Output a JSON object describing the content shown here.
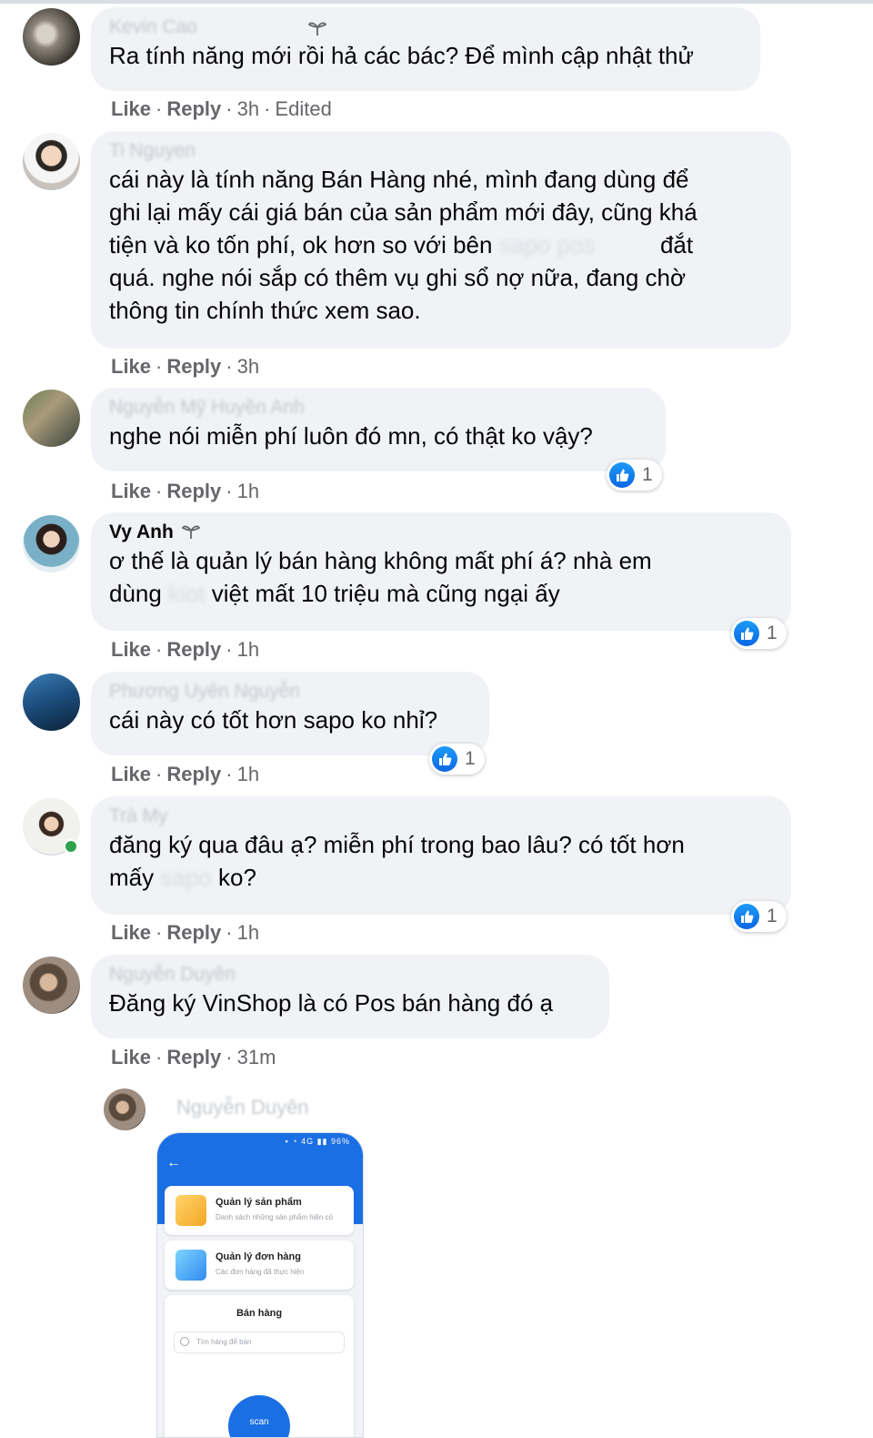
{
  "comments": [
    {
      "name": "Kevin Cao",
      "text": [
        "Ra tính năng mới rồi hả các bác? Để mình cập nhật thử"
      ],
      "time": "3h",
      "edited": "Edited",
      "reactions": null
    },
    {
      "name": "Ti Nguyen",
      "text": [
        "cái này là tính năng Bán Hàng nhé, mình đang dùng để",
        "ghi lại mấy cái giá bán của sản phẩm mới đây, cũng khá",
        "tiện và ko tốn phí, ok hơn so với bên",
        "đắt",
        "quá. nghe nói sắp có thêm vụ ghi sổ nợ nữa, đang chờ",
        "thông tin chính thức xem sao."
      ],
      "redacted": "sapo pos",
      "time": "3h",
      "reactions": null
    },
    {
      "name": "Nguyễn Mỹ Huyền Anh",
      "text": [
        "nghe nói miễn phí luôn đó mn, có thật ko vậy?"
      ],
      "time": "1h",
      "reactions": "1"
    },
    {
      "name": "Vy Anh",
      "text": [
        "ơ thế là quản lý bán hàng không mất phí á? nhà em",
        "dùng",
        "việt mất 10 triệu mà cũng ngại ấy"
      ],
      "redacted": "kiot",
      "time": "1h",
      "reactions": "1"
    },
    {
      "name": "Phương Uyên Nguyễn",
      "text": [
        "cái này có tốt hơn sapo ko nhỉ?"
      ],
      "time": "1h",
      "reactions": "1"
    },
    {
      "name": "Trà My",
      "text": [
        "đăng ký qua đâu ạ? miễn phí trong bao lâu? có tốt hơn",
        "mấy",
        "ko?"
      ],
      "redacted": "sapo",
      "time": "1h",
      "reactions": "1"
    },
    {
      "name": "Nguyễn Duyên",
      "text": [
        "Đăng ký VinShop là có Pos bán hàng đó ạ"
      ],
      "time": "31m",
      "reactions": null
    }
  ],
  "actions": {
    "like": "Like",
    "reply": "Reply",
    "dot": "·"
  },
  "reply": {
    "name": "Nguyễn Duyên",
    "phone": {
      "status": "▪ ◔ 4G ▮▮ 96%",
      "back": "←",
      "cards": [
        {
          "title": "Quản lý sản phẩm",
          "subtitle": "Danh sách những sản phẩm hiện có"
        },
        {
          "title": "Quản lý đơn hàng",
          "subtitle": "Các đơn hàng đã thực hiện"
        }
      ],
      "section": "Bán hàng",
      "search_placeholder": "Tìm hàng để bán",
      "fab": "scan"
    }
  },
  "colors": {
    "bubble": "#f0f2f5",
    "meta": "#65676b",
    "like_blue": "#1b74e4",
    "online": "#31a24c"
  }
}
